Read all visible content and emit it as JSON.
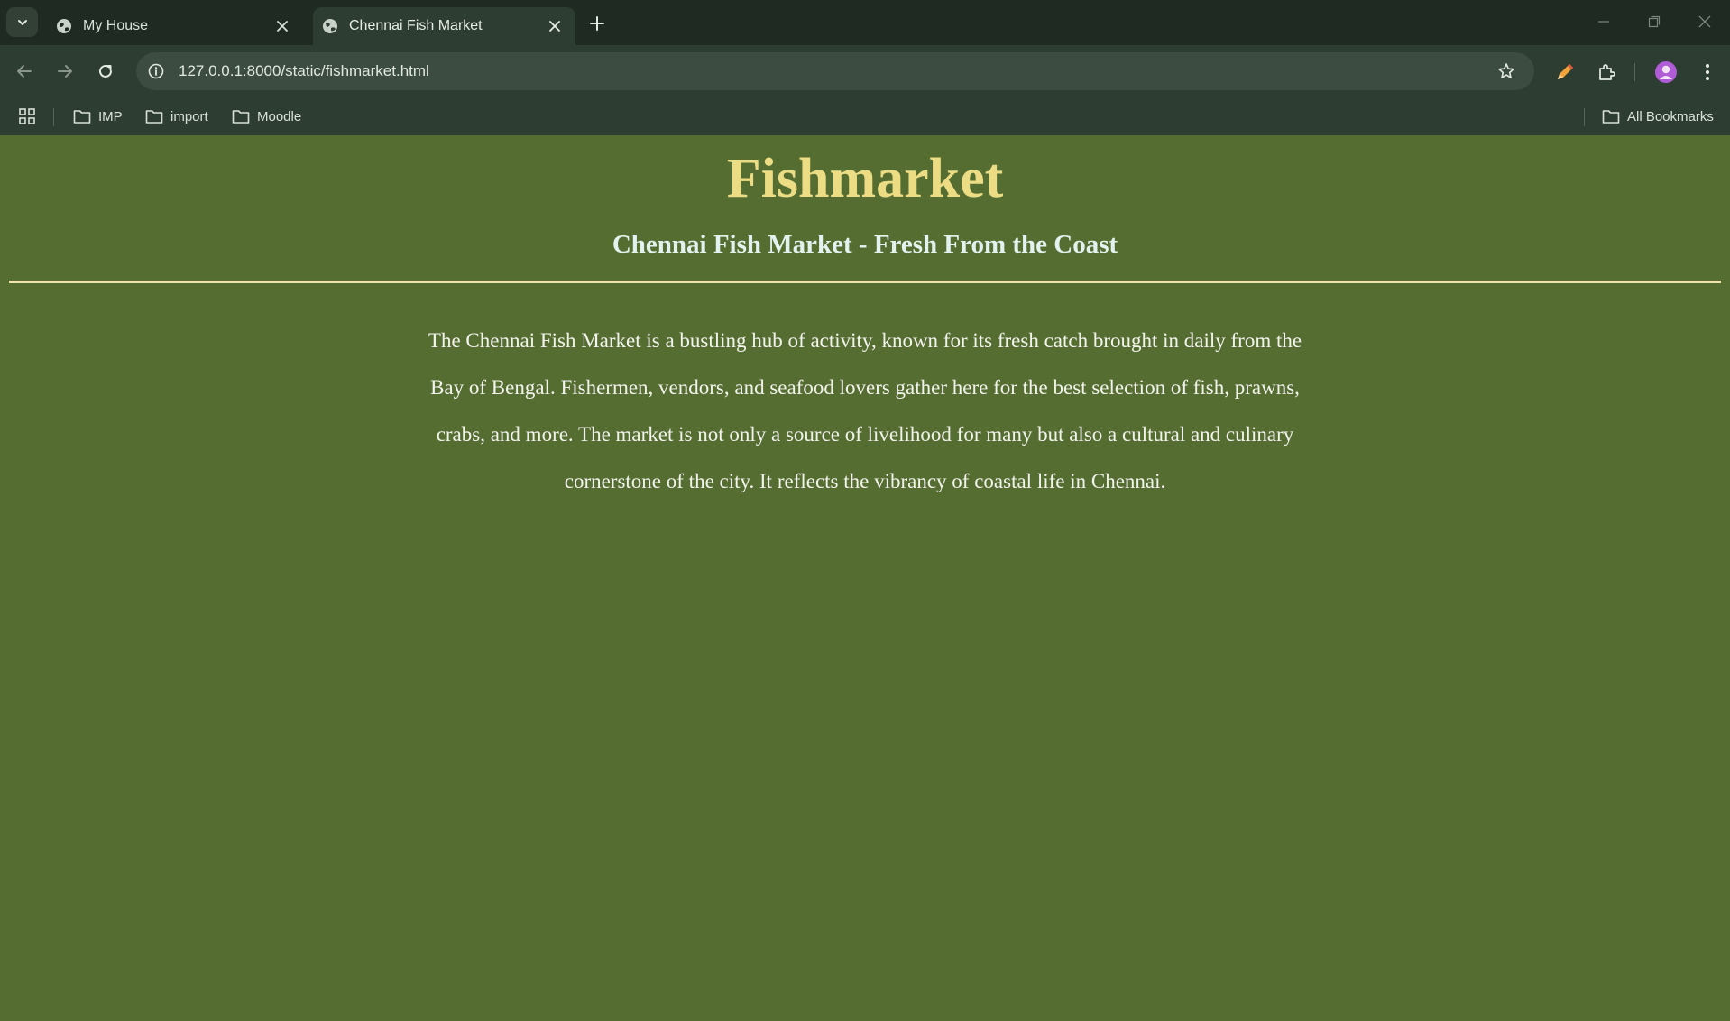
{
  "tabs": [
    {
      "title": "My House",
      "active": false
    },
    {
      "title": "Chennai Fish Market",
      "active": true
    }
  ],
  "toolbar": {
    "url": "127.0.0.1:8000/static/fishmarket.html"
  },
  "bookmarks": {
    "items": [
      {
        "label": "IMP"
      },
      {
        "label": "import"
      },
      {
        "label": "Moodle"
      }
    ],
    "all_bookmarks_label": "All Bookmarks"
  },
  "page": {
    "title": "Fishmarket",
    "subtitle": "Chennai Fish Market - Fresh From the Coast",
    "paragraph": "The Chennai Fish Market is a bustling hub of activity, known for its fresh catch brought in daily from the Bay of Bengal. Fishermen, vendors, and seafood lovers gather here for the best selection of fish, prawns, crabs, and more. The market is not only a source of livelihood for many but also a cultural and culinary cornerstone of the city. It reflects the vibrancy of coastal life in Chennai."
  },
  "colors": {
    "page_background": "#566d31",
    "title": "#ecdd84",
    "subtitle": "#e3f2ee",
    "rule": "#efe4ad",
    "body_text": "#f3f3ee",
    "browser_frame": "#1f2b22",
    "toolbar": "#2e3d31"
  },
  "icons": {
    "tab_search": "chevron-down-icon",
    "favicon": "globe-icon",
    "tab_close": "close-icon",
    "new_tab": "plus-icon",
    "back": "arrow-left-icon",
    "forward": "arrow-right-icon",
    "reload": "reload-icon",
    "site_info": "info-icon",
    "bookmark_star": "star-icon",
    "pencil_extension": "pencil-icon",
    "extensions": "puzzle-icon",
    "profile": "avatar",
    "menu": "kebab-menu-icon",
    "apps": "apps-grid-icon",
    "folder": "folder-icon"
  }
}
